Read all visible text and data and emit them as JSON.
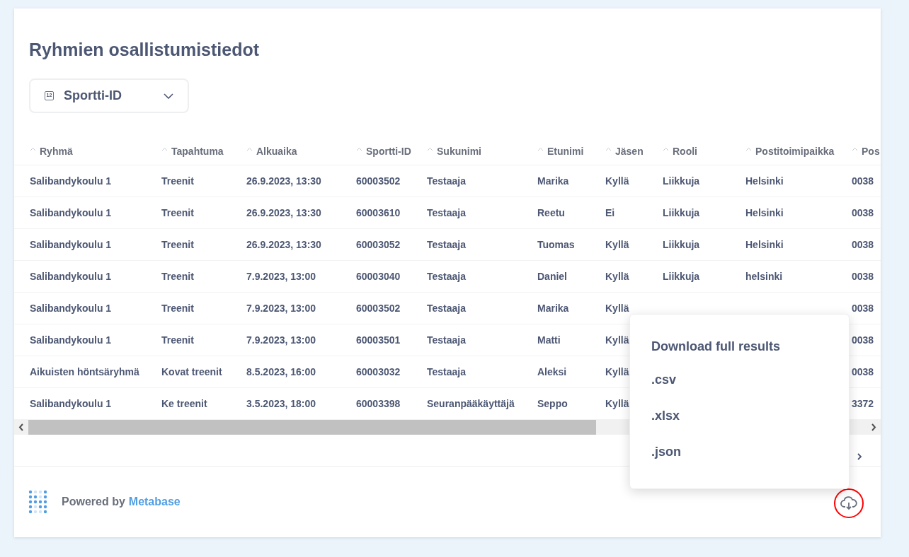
{
  "title": "Ryhmien osallistumistiedot",
  "filter": {
    "label": "Sportti-ID",
    "icon_text": "12"
  },
  "table": {
    "columns": [
      "Ryhmä",
      "Tapahtuma",
      "Alkuaika",
      "Sportti-ID",
      "Sukunimi",
      "Etunimi",
      "Jäsen",
      "Rooli",
      "Postitoimipaikka",
      "Pos"
    ],
    "rows": [
      [
        "Salibandykoulu 1",
        "Treenit",
        "26.9.2023, 13:30",
        "60003502",
        "Testaaja",
        "Marika",
        "Kyllä",
        "Liikkuja",
        "Helsinki",
        "0038"
      ],
      [
        "Salibandykoulu 1",
        "Treenit",
        "26.9.2023, 13:30",
        "60003610",
        "Testaaja",
        "Reetu",
        "Ei",
        "Liikkuja",
        "Helsinki",
        "0038"
      ],
      [
        "Salibandykoulu 1",
        "Treenit",
        "26.9.2023, 13:30",
        "60003052",
        "Testaaja",
        "Tuomas",
        "Kyllä",
        "Liikkuja",
        "Helsinki",
        "0038"
      ],
      [
        "Salibandykoulu 1",
        "Treenit",
        "7.9.2023, 13:00",
        "60003040",
        "Testaaja",
        "Daniel",
        "Kyllä",
        "Liikkuja",
        "helsinki",
        "0038"
      ],
      [
        "Salibandykoulu 1",
        "Treenit",
        "7.9.2023, 13:00",
        "60003502",
        "Testaaja",
        "Marika",
        "Kyllä",
        null,
        null,
        "0038"
      ],
      [
        "Salibandykoulu 1",
        "Treenit",
        "7.9.2023, 13:00",
        "60003501",
        "Testaaja",
        "Matti",
        "Kyllä",
        null,
        null,
        "0038"
      ],
      [
        "Aikuisten höntsäryhmä",
        "Kovat treenit",
        "8.5.2023, 16:00",
        "60003032",
        "Testaaja",
        "Aleksi",
        "Kyllä",
        null,
        null,
        "0038"
      ],
      [
        "Salibandykoulu 1",
        "Ke treenit",
        "3.5.2023, 18:00",
        "60003398",
        "Seuranpääkäyttäjä",
        "Seppo",
        "Kyllä",
        null,
        null,
        "3372"
      ]
    ]
  },
  "footer": {
    "powered_by": "Powered by",
    "brand": "Metabase"
  },
  "download_menu": {
    "title": "Download full results",
    "options": [
      ".csv",
      ".xlsx",
      ".json"
    ]
  }
}
